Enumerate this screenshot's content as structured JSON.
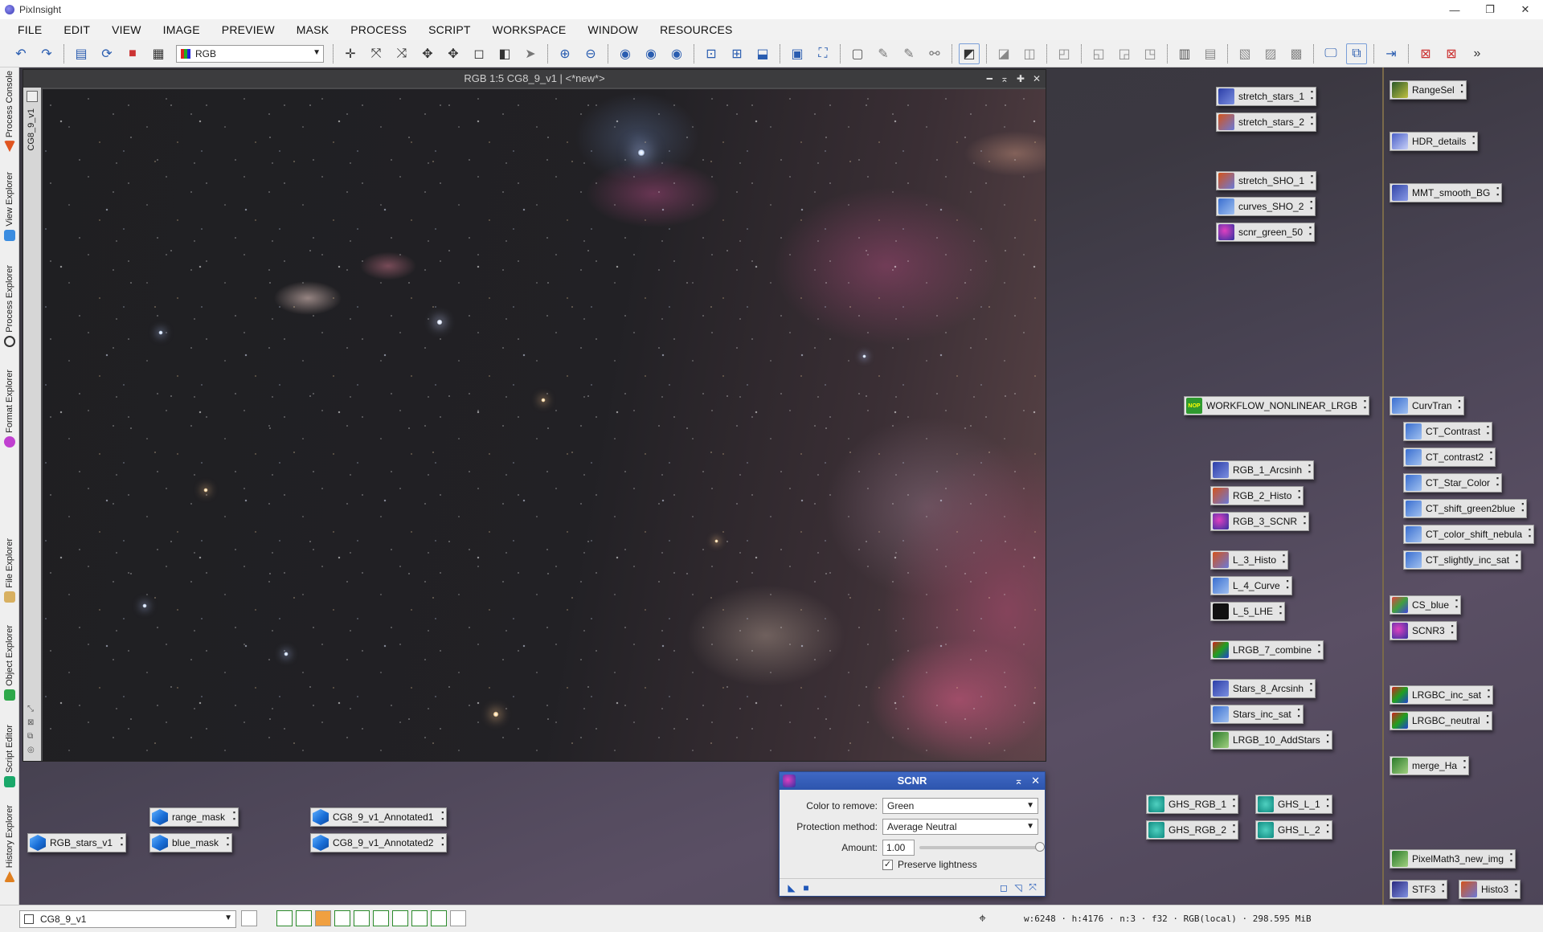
{
  "app": {
    "title": "PixInsight"
  },
  "window_controls": {
    "minimize": "—",
    "restore": "❐",
    "close": "✕"
  },
  "menu": [
    "FILE",
    "EDIT",
    "VIEW",
    "IMAGE",
    "PREVIEW",
    "MASK",
    "PROCESS",
    "SCRIPT",
    "WORKSPACE",
    "WINDOW",
    "RESOURCES"
  ],
  "toolbar": {
    "channel_select": "RGB",
    "more": "»"
  },
  "side_tabs": {
    "process_console": "Process Console",
    "view_explorer": "View Explorer",
    "process_explorer": "Process Explorer",
    "format_explorer": "Format Explorer",
    "file_explorer": "File Explorer",
    "object_explorer": "Object Explorer",
    "script_editor": "Script Editor",
    "history_explorer": "History Explorer"
  },
  "image_window": {
    "title": "RGB 1:5 CG8_9_v1 | <*new*>",
    "side_tab": "CG8_9_v1"
  },
  "process_icons": {
    "col1": [
      "stretch_stars_1",
      "stretch_stars_2",
      "stretch_SHO_1",
      "curves_SHO_2",
      "scnr_green_50",
      "WORKFLOW_NONLINEAR_LRGB",
      "RGB_1_Arcsinh",
      "RGB_2_Histo",
      "RGB_3_SCNR",
      "L_3_Histo",
      "L_4_Curve",
      "L_5_LHE",
      "LRGB_7_combine",
      "Stars_8_Arcsinh",
      "Stars_inc_sat",
      "LRGB_10_AddStars"
    ],
    "ghs": [
      "GHS_RGB_1",
      "GHS_L_1",
      "GHS_RGB_2",
      "GHS_L_2"
    ],
    "col2": [
      "RangeSel",
      "HDR_details",
      "MMT_smooth_BG",
      "CurvTran",
      "CT_Contrast",
      "CT_contrast2",
      "CT_Star_Color",
      "CT_shift_green2blue",
      "CT_color_shift_nebula",
      "CT_slightly_inc_sat",
      "CS_blue",
      "SCNR3",
      "LRGBC_inc_sat",
      "LRGBC_neutral",
      "merge_Ha",
      "PixelMath3_new_img",
      "STF3",
      "Histo3"
    ],
    "nop_badge": "NOP"
  },
  "image_icons": [
    "RGB_stars_v1",
    "range_mask",
    "blue_mask",
    "CG8_9_v1_Annotated1",
    "CG8_9_v1_Annotated2"
  ],
  "scnr": {
    "title": "SCNR",
    "color_label": "Color to remove:",
    "color_value": "Green",
    "protection_label": "Protection method:",
    "protection_value": "Average Neutral",
    "amount_label": "Amount:",
    "amount_value": "1.00",
    "amount_fraction": 1.0,
    "preserve_label": "Preserve lightness",
    "preserve_checked": true
  },
  "statusbar": {
    "view_select": "CG8_9_v1",
    "info": "w:6248 · h:4176 · n:3 · f32 · RGB(local) · 298.595 MiB"
  }
}
